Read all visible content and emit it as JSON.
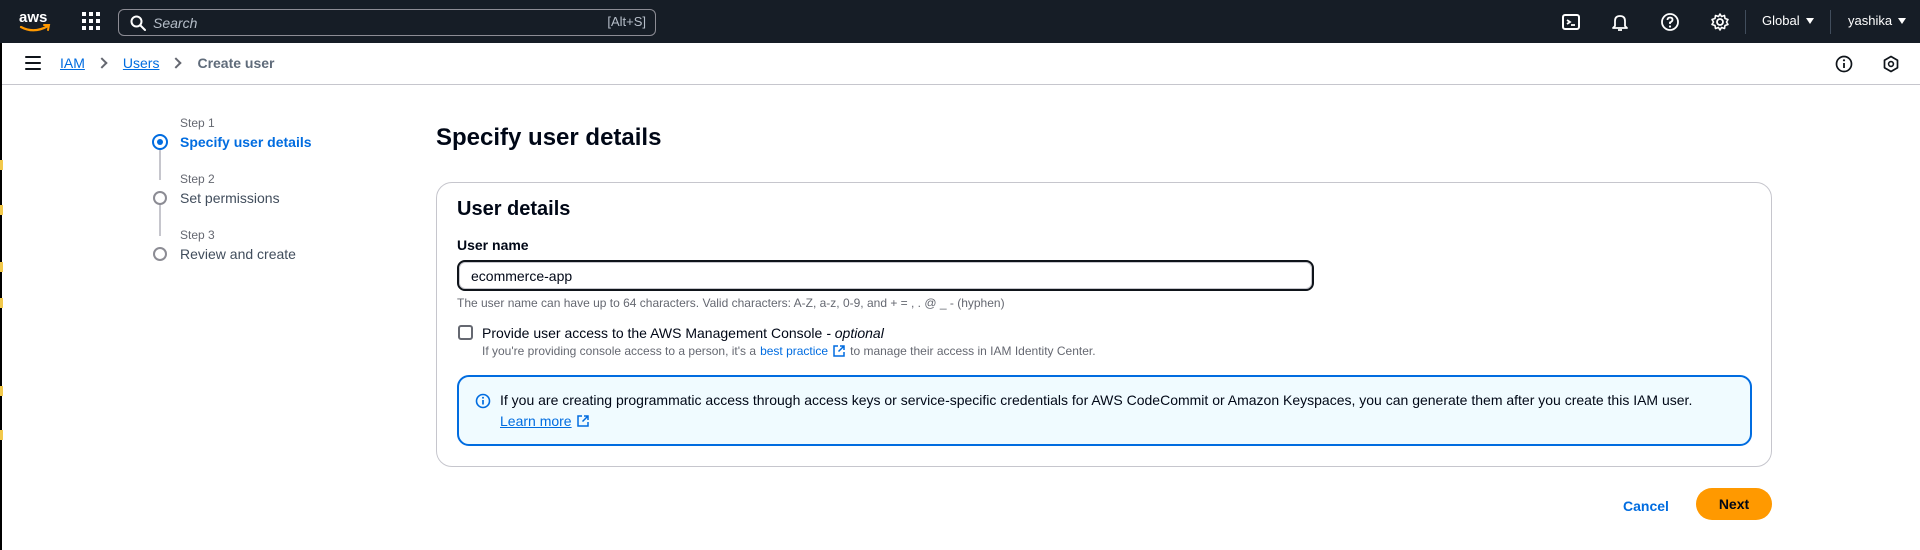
{
  "topnav": {
    "logo_text": "aws",
    "search_placeholder": "Search",
    "search_shortcut": "[Alt+S]",
    "region_label": "Global",
    "user_label": "yashika",
    "icons": [
      "cloudshell-icon",
      "bell-icon",
      "help-icon",
      "gear-icon"
    ]
  },
  "breadcrumb": {
    "items": [
      "IAM",
      "Users"
    ],
    "current": "Create user"
  },
  "steps": [
    {
      "label": "Step 1",
      "title": "Specify user details",
      "active": true
    },
    {
      "label": "Step 2",
      "title": "Set permissions",
      "active": false
    },
    {
      "label": "Step 3",
      "title": "Review and create",
      "active": false
    }
  ],
  "page": {
    "title": "Specify user details"
  },
  "user_details": {
    "title": "User details",
    "user_name_label": "User name",
    "user_name_value": "ecommerce-app",
    "user_name_hint": "The user name can have up to 64 characters. Valid characters: A-Z, a-z, 0-9, and + = , . @ _ - (hyphen)",
    "console_access_label": "Provide user access to the AWS Management Console",
    "console_access_optional": "- optional",
    "console_access_desc_before": "If you're providing console access to a person, it's a",
    "console_access_link": "best practice",
    "console_access_desc_after": "to manage their access in IAM Identity Center.",
    "console_access_checked": false
  },
  "alert": {
    "text": "If you are creating programmatic access through access keys or service-specific credentials for AWS CodeCommit or Amazon Keyspaces, you can generate them after you create this IAM user.",
    "link": "Learn more"
  },
  "actions": {
    "cancel": "Cancel",
    "next": "Next"
  },
  "colors": {
    "nav_bg": "#161d26",
    "link": "#006ce0",
    "primary_button": "#ff9900",
    "alert_bg": "#f0fbff"
  }
}
